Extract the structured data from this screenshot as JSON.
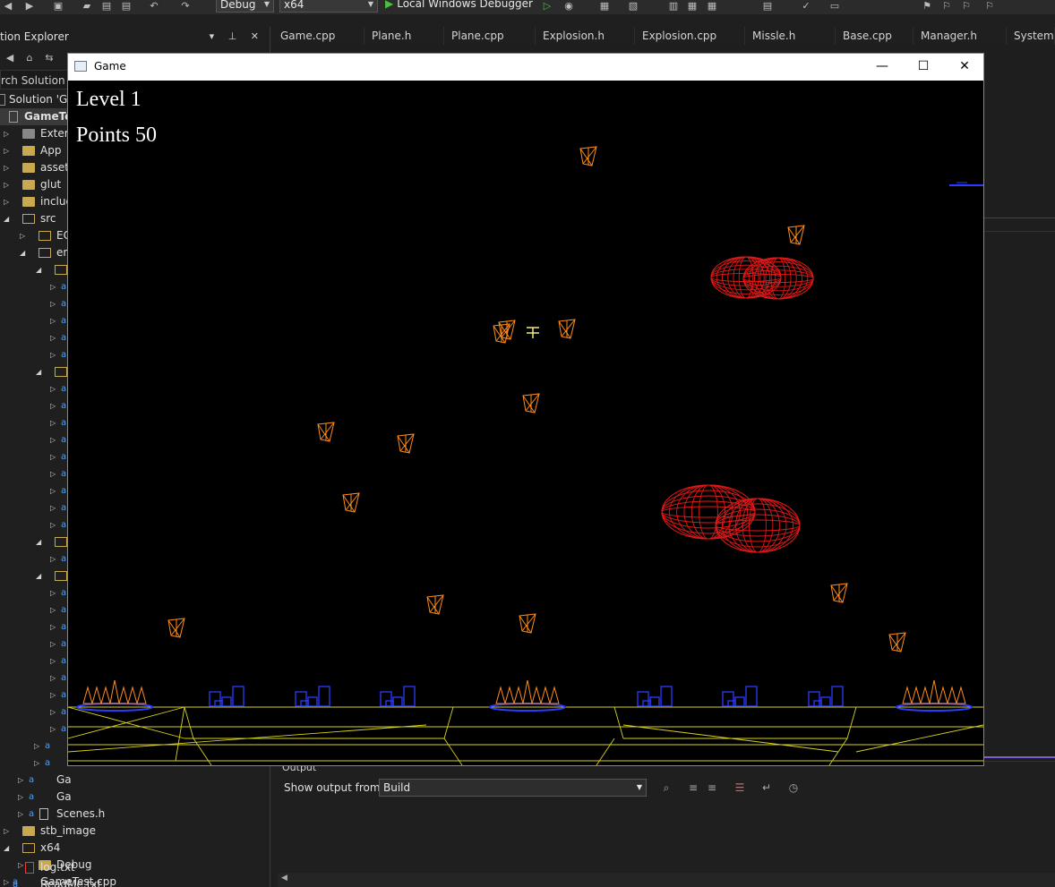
{
  "toolbar": {
    "config_value": "Debug",
    "platform_value": "x64",
    "debugger_label": "Local Windows Debugger"
  },
  "solution_explorer": {
    "title": "tion Explorer",
    "search_placeholder": "rch Solution Ex",
    "items": [
      {
        "label": "Solution 'Ga"
      },
      {
        "label": "GameTes"
      },
      {
        "label": "Extern"
      },
      {
        "label": "App"
      },
      {
        "label": "assets"
      },
      {
        "label": "glut"
      },
      {
        "label": "incluc"
      },
      {
        "label": "src"
      },
      {
        "label": "EC"
      },
      {
        "label": "en"
      },
      {
        "label": "Ga"
      },
      {
        "label": "Ga"
      },
      {
        "label": "Scenes.h"
      },
      {
        "label": "stb_image"
      },
      {
        "label": "x64"
      },
      {
        "label": "Debug"
      },
      {
        "label": "GameTest.cpp"
      },
      {
        "label": "log.txt"
      },
      {
        "label": "ReadMe.txt"
      }
    ]
  },
  "tabs": [
    {
      "label": "Game.cpp"
    },
    {
      "label": "Plane.h"
    },
    {
      "label": "Plane.cpp"
    },
    {
      "label": "Explosion.h"
    },
    {
      "label": "Explosion.cpp"
    },
    {
      "label": "Missle.h"
    },
    {
      "label": "Base.cpp"
    },
    {
      "label": "Manager.h"
    },
    {
      "label": "System.h"
    }
  ],
  "output": {
    "title": "Output",
    "show_from_label": "Show output from:",
    "source_value": "Build"
  },
  "game_window": {
    "title": "Game",
    "level_text": "Level 1",
    "points_text": "Points 50"
  },
  "colors": {
    "plane": "#ff8c1a",
    "explosion": "#e01818",
    "base": "#2a3cff",
    "ground": "#d8d020",
    "cursor": "#f2e87a"
  }
}
